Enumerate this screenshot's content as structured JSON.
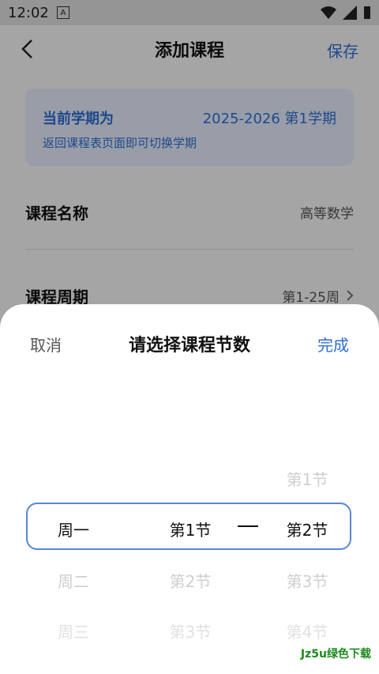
{
  "status": {
    "time": "12:02",
    "badge": "A"
  },
  "header": {
    "title": "添加课程",
    "save_label": "保存"
  },
  "term": {
    "label": "当前学期为",
    "value": "2025-2026  第1学期",
    "hint": "返回课程表页面即可切换学期"
  },
  "course_name": {
    "label": "课程名称",
    "value": "高等数学"
  },
  "course_cycle": {
    "label": "课程周期",
    "value": "第1-25周"
  },
  "picker": {
    "cancel": "取消",
    "title": "请选择课程节数",
    "done": "完成",
    "days": [
      {
        "label": "周一"
      },
      {
        "label": "周二"
      },
      {
        "label": "周三"
      }
    ],
    "start": [
      {
        "label": "第1节"
      },
      {
        "label": "第2节"
      },
      {
        "label": "第3节"
      }
    ],
    "end": [
      {
        "label": "第1节"
      },
      {
        "label": "第2节"
      },
      {
        "label": "第3节"
      },
      {
        "label": "第4节"
      }
    ],
    "separator": "—"
  },
  "watermark": "Jz5u绿色下载"
}
